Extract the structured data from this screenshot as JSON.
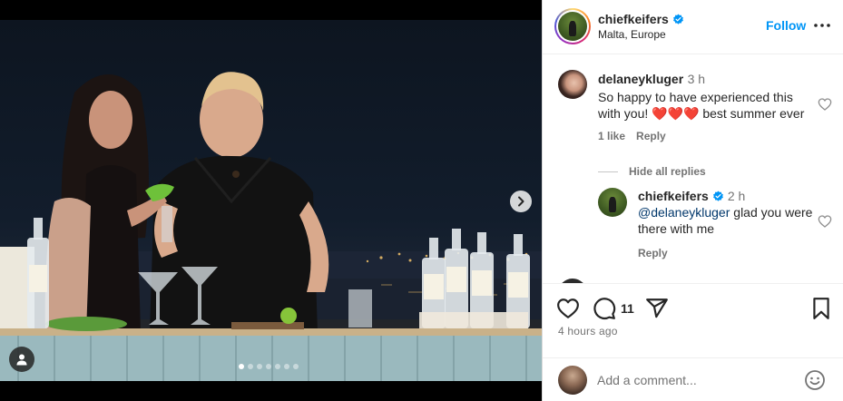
{
  "post": {
    "username": "chiefkeifers",
    "location": "Malta, Europe",
    "follow_label": "Follow",
    "likes_count": "11",
    "time_ago": "4 hours ago"
  },
  "media": {
    "carousel_total": 7,
    "carousel_active": 0
  },
  "comments": [
    {
      "username": "delaneykluger",
      "time": "3 h",
      "text": "So happy to have experienced this with you! ❤️❤️❤️ best summer ever",
      "likes": "1 like",
      "reply_label": "Reply",
      "replies_toggle": "Hide all replies"
    }
  ],
  "reply": {
    "username": "chiefkeifers",
    "time": "2 h",
    "mention": "@delaneykluger",
    "text": " glad you were there with me",
    "reply_label": "Reply"
  },
  "composer": {
    "placeholder": "Add a comment..."
  },
  "colors": {
    "accent": "#0095f6",
    "verified": "#0095f6",
    "mention": "#00376b",
    "secondary_text": "#737373"
  }
}
